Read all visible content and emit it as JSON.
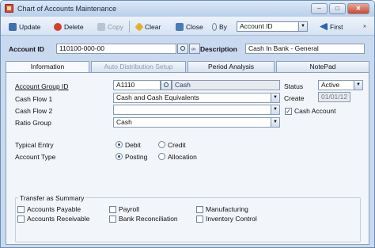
{
  "window": {
    "title": "Chart of Accounts Maintenance",
    "controls": {
      "minimize": "–",
      "maximize": "□",
      "close": "✕"
    }
  },
  "toolbar": {
    "update": "Update",
    "delete": "Delete",
    "copy": "Copy",
    "clear": "Clear",
    "close": "Close",
    "by_label": "By",
    "by_value": "Account ID",
    "first": "First"
  },
  "header": {
    "account_id_label": "Account ID",
    "account_id_value": "110100-000-00",
    "description_label": "Description",
    "description_value": "Cash In Bank - General"
  },
  "tabs": [
    {
      "label": "Information",
      "active": true,
      "enabled": true
    },
    {
      "label": "Auto Distribution Setup",
      "active": false,
      "enabled": false
    },
    {
      "label": "Period Analysis",
      "active": false,
      "enabled": true
    },
    {
      "label": "NotePad",
      "active": false,
      "enabled": true
    }
  ],
  "info": {
    "account_group_label": "Account Group ID",
    "account_group_value": "A1110",
    "account_group_desc": "Cash",
    "cash_flow_1_label": "Cash Flow 1",
    "cash_flow_1_value": "Cash and Cash Equivalents",
    "cash_flow_2_label": "Cash Flow 2",
    "cash_flow_2_value": "",
    "ratio_group_label": "Ratio Group",
    "ratio_group_value": "Cash",
    "status_label": "Status",
    "status_value": "Active",
    "create_label": "Create",
    "create_value": "01/01/12",
    "cash_account_label": "Cash Account",
    "cash_account_checked": true,
    "typical_entry_label": "Typical Entry",
    "typical_entry_options": [
      "Debit",
      "Credit"
    ],
    "typical_entry_selected": "Debit",
    "account_type_label": "Account Type",
    "account_type_options": [
      "Posting",
      "Allocation"
    ],
    "account_type_selected": "Posting"
  },
  "transfer": {
    "title": "Transfer as Summary",
    "items": [
      {
        "label": "Accounts Payable",
        "checked": false
      },
      {
        "label": "Accounts Receivable",
        "checked": false
      },
      {
        "label": "Payroll",
        "checked": false
      },
      {
        "label": "Bank Reconciliation",
        "checked": false
      },
      {
        "label": "Manufacturing",
        "checked": false
      },
      {
        "label": "Inventory Control",
        "checked": false
      }
    ]
  },
  "colors": {
    "accent": "#1a3d7c",
    "title_bar": "#c9daf0",
    "panel": "#f2f5f9"
  }
}
